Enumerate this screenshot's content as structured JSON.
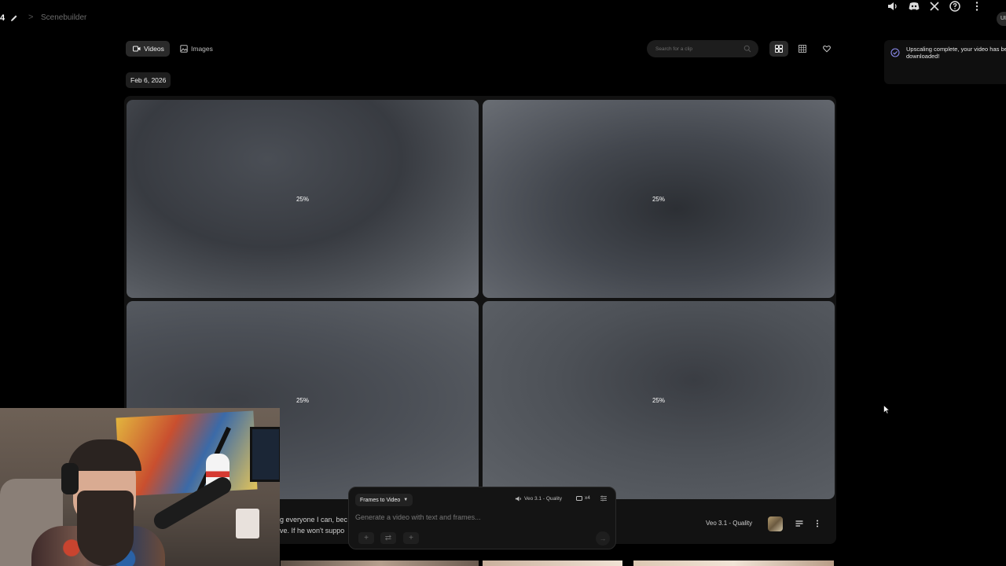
{
  "header": {
    "crumb_number": "4",
    "separator": ">",
    "project_title": "Scenebuilder",
    "icons": [
      "volume-icon",
      "discord-icon",
      "x-icon",
      "help-icon",
      "more-icon"
    ],
    "avatar_text": "UI"
  },
  "toolbar": {
    "tabs": [
      {
        "label": "Videos",
        "icon": "video-icon",
        "active": true
      },
      {
        "label": "Images",
        "icon": "image-icon",
        "active": false
      }
    ],
    "search_placeholder": "Search for a clip",
    "view_modes": [
      "grid-large-icon",
      "grid-small-icon",
      "favorite-icon"
    ]
  },
  "toast": {
    "message": "Upscaling complete, your video has been downloaded!"
  },
  "date_chip": "Feb 6, 2026",
  "tiles": [
    {
      "progress": "25%"
    },
    {
      "progress": "25%"
    },
    {
      "progress": "25%"
    },
    {
      "progress": "25%"
    }
  ],
  "grid_footer": {
    "text_line1": "g everyone I can, bec",
    "text_line2": "ve. If he won't suppo",
    "model": "Veo 3.1 - Quality"
  },
  "composer": {
    "mode": "Frames to Video",
    "quality": "Veo 3.1 - Quality",
    "count": "x4",
    "prompt_placeholder": "Generate a video with text and frames..."
  },
  "colors": {
    "background": "#000000",
    "panel": "#121212",
    "toast_check": "#8c8cf0"
  }
}
